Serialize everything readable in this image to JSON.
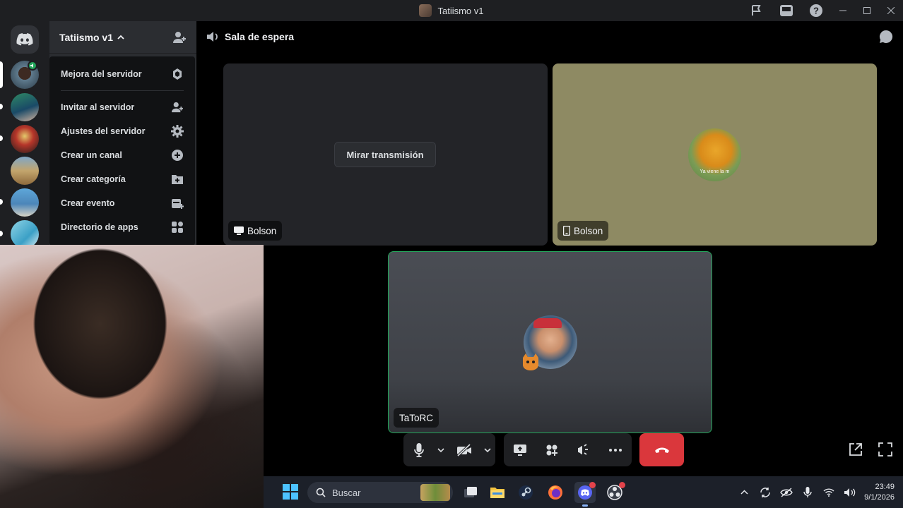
{
  "window": {
    "title": "Tatiismo v1"
  },
  "server": {
    "name": "Tatiismo v1",
    "menu": [
      {
        "label": "Mejora del servidor",
        "icon": "boost-icon"
      },
      {
        "label": "Invitar al servidor",
        "icon": "invite-icon"
      },
      {
        "label": "Ajustes del servidor",
        "icon": "gear-icon"
      },
      {
        "label": "Crear un canal",
        "icon": "plus-circle-icon"
      },
      {
        "label": "Crear categoría",
        "icon": "folder-plus-icon"
      },
      {
        "label": "Crear evento",
        "icon": "calendar-plus-icon"
      },
      {
        "label": "Directorio de apps",
        "icon": "apps-icon"
      }
    ]
  },
  "channel": {
    "name": "Sala de espera"
  },
  "tiles": {
    "stream": {
      "user": "Bolson",
      "action": "Mirar transmisión"
    },
    "mobile": {
      "user": "Bolson",
      "avatar_caption": "Ya viene la m"
    },
    "camera": {
      "user": "TaToRC"
    }
  },
  "taskbar": {
    "search_placeholder": "Buscar",
    "time": "23:49",
    "date": "9/1/2026"
  },
  "colors": {
    "hangup": "#da373c",
    "speaking": "#23a55a",
    "mobile_tile": "#8e8a63"
  }
}
